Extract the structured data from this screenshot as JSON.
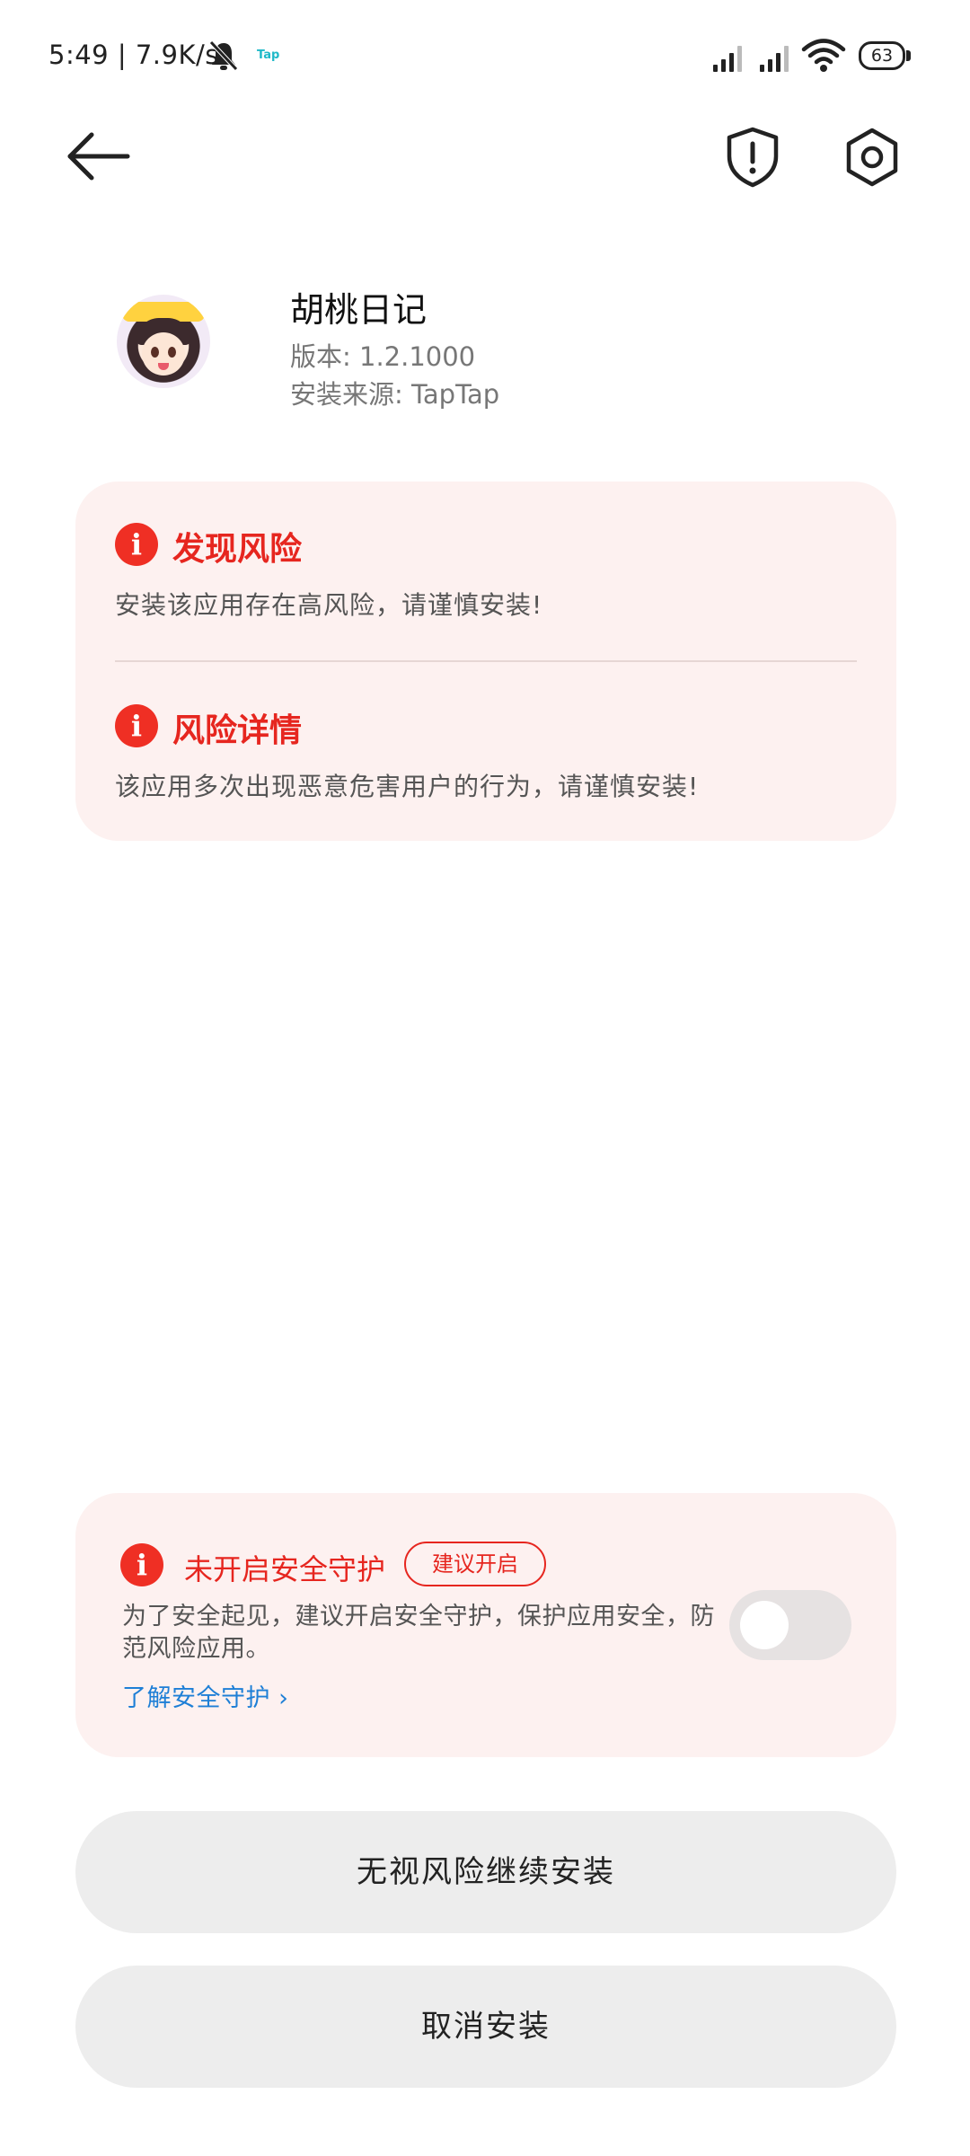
{
  "status_bar": {
    "time": "5:49",
    "speed": "7.9K/s",
    "tap_label": "Tap",
    "battery": "63"
  },
  "app": {
    "name": "胡桃日记",
    "version_label": "版本: 1.2.1000",
    "source_label": "安装来源: TapTap"
  },
  "risk_card": {
    "section1_title": "发现风险",
    "section1_desc": "安装该应用存在高风险，请谨慎安装!",
    "section2_title": "风险详情",
    "section2_desc": "该应用多次出现恶意危害用户的行为，请谨慎安装!",
    "info_glyph": "i",
    "accent_color": "#e6261f"
  },
  "security": {
    "title": "未开启安全守护",
    "badge": "建议开启",
    "desc": "为了安全起见，建议开启安全守护，保护应用安全，防范风险应用。",
    "link": "了解安全守护 ›",
    "toggle_on": false
  },
  "buttons": {
    "continue_label": "无视风险继续安装",
    "cancel_label": "取消安装"
  }
}
